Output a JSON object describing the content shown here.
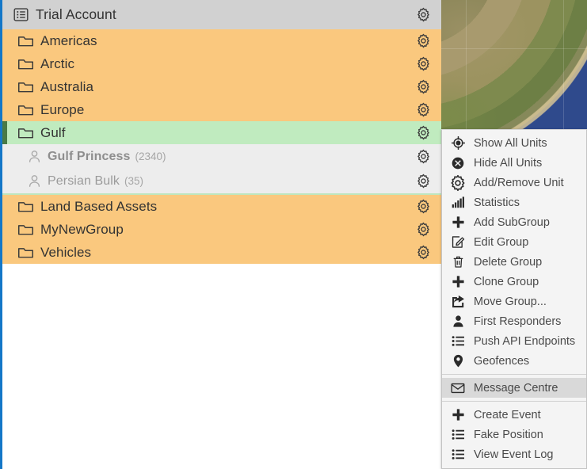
{
  "panel": {
    "header": {
      "label": "Trial Account",
      "icon": "list-grid-icon"
    },
    "rows": [
      {
        "type": "group",
        "label": "Americas",
        "icon": "folder-icon",
        "gear": "gear-icon"
      },
      {
        "type": "group",
        "label": "Arctic",
        "icon": "folder-icon",
        "gear": "gear-icon"
      },
      {
        "type": "group",
        "label": "Australia",
        "icon": "folder-icon",
        "gear": "gear-icon"
      },
      {
        "type": "group",
        "label": "Europe",
        "icon": "folder-icon",
        "gear": "gear-icon"
      },
      {
        "type": "group-selected",
        "label": "Gulf",
        "icon": "folder-icon",
        "gear": "gear-icon"
      },
      {
        "type": "unit",
        "label": "Gulf Princess",
        "count": "(2340)",
        "bold": true,
        "icon": "person-icon",
        "gear": "gear-icon"
      },
      {
        "type": "unit",
        "label": "Persian Bulk",
        "count": "(35)",
        "bold": false,
        "icon": "person-icon",
        "gear": "gear-icon"
      },
      {
        "type": "group",
        "label": "Land Based Assets",
        "icon": "folder-icon",
        "gear": "gear-icon"
      },
      {
        "type": "group",
        "label": "MyNewGroup",
        "icon": "folder-icon",
        "gear": "gear-icon"
      },
      {
        "type": "group",
        "label": "Vehicles",
        "icon": "folder-icon",
        "gear": "gear-icon"
      }
    ]
  },
  "context_menu": {
    "items": [
      {
        "label": "Show All Units",
        "icon": "crosshair-icon",
        "highlight": false,
        "sep_after": false
      },
      {
        "label": "Hide All Units",
        "icon": "x-circle-icon",
        "highlight": false,
        "sep_after": false
      },
      {
        "label": "Add/Remove Unit",
        "icon": "gear-icon",
        "highlight": false,
        "sep_after": false
      },
      {
        "label": "Statistics",
        "icon": "bar-chart-icon",
        "highlight": false,
        "sep_after": false
      },
      {
        "label": "Add SubGroup",
        "icon": "plus-icon",
        "highlight": false,
        "sep_after": false
      },
      {
        "label": "Edit Group",
        "icon": "pencil-square-icon",
        "highlight": false,
        "sep_after": false
      },
      {
        "label": "Delete Group",
        "icon": "trash-icon",
        "highlight": false,
        "sep_after": false
      },
      {
        "label": "Clone Group",
        "icon": "plus-icon",
        "highlight": false,
        "sep_after": false
      },
      {
        "label": "Move Group...",
        "icon": "share-arrow-icon",
        "highlight": false,
        "sep_after": false
      },
      {
        "label": "First Responders",
        "icon": "person-filled-icon",
        "highlight": false,
        "sep_after": false
      },
      {
        "label": "Push API Endpoints",
        "icon": "list-icon",
        "highlight": false,
        "sep_after": false
      },
      {
        "label": "Geofences",
        "icon": "map-pin-icon",
        "highlight": false,
        "sep_after": true
      },
      {
        "label": "Message Centre",
        "icon": "envelope-icon",
        "highlight": true,
        "sep_after": true
      },
      {
        "label": "Create Event",
        "icon": "plus-icon",
        "highlight": false,
        "sep_after": false
      },
      {
        "label": "Fake Position",
        "icon": "list-icon",
        "highlight": false,
        "sep_after": false
      },
      {
        "label": "View Event Log",
        "icon": "list-icon",
        "highlight": false,
        "sep_after": false
      }
    ]
  },
  "map": {
    "name": "satellite-map",
    "ocean_color": "#2c4483",
    "land_color": "#8a8558"
  },
  "colors": {
    "group_row": "#fac87e",
    "selected_row": "#c0ebbf",
    "header_row": "#d1d1d1",
    "unit_row": "#ededed",
    "panel_border": "#1477c8",
    "accent_bar": "#4a7a46"
  }
}
